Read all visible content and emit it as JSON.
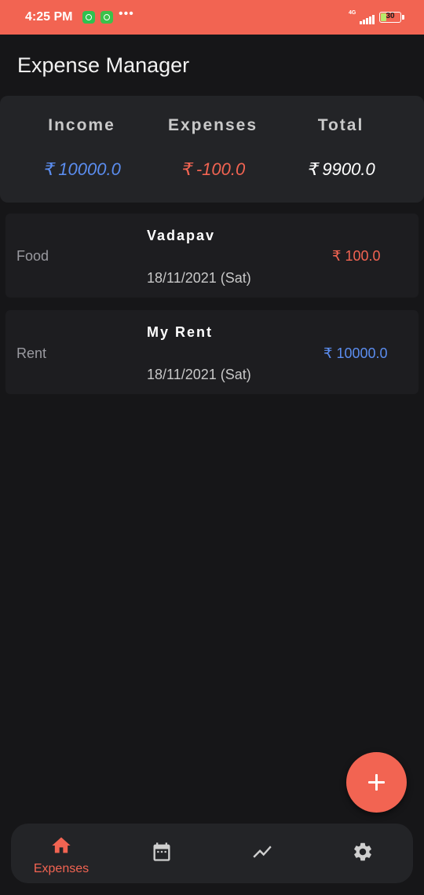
{
  "status_bar": {
    "time": "4:25 PM",
    "network": "4G",
    "battery": "30",
    "battery_level": 0.3,
    "icons": [
      "whatsapp-icon",
      "android-icon",
      "more-notifications-icon",
      "signal-icon",
      "battery-icon"
    ]
  },
  "app_bar": {
    "title": "Expense Manager"
  },
  "summary": {
    "income_label": "Income",
    "income_value": "₹ 10000.0",
    "expenses_label": "Expenses",
    "expenses_value": "₹ -100.0",
    "total_label": "Total",
    "total_value": "₹ 9900.0"
  },
  "transactions": [
    {
      "category": "Food",
      "title": "Vadapav",
      "date": "18/11/2021 (Sat)",
      "amount": "₹ 100.0",
      "type": "expense"
    },
    {
      "category": "Rent",
      "title": "My Rent",
      "date": "18/11/2021 (Sat)",
      "amount": "₹ 10000.0",
      "type": "income"
    }
  ],
  "fab": {
    "icon": "plus-icon"
  },
  "bottom_nav": {
    "items": [
      {
        "label": "Expenses",
        "icon": "home-icon",
        "active": true
      },
      {
        "label": "",
        "icon": "calendar-icon",
        "active": false
      },
      {
        "label": "",
        "icon": "chart-icon",
        "active": false
      },
      {
        "label": "",
        "icon": "gear-icon",
        "active": false
      }
    ]
  },
  "colors": {
    "accent": "#f26452",
    "income": "#5b8def",
    "expense": "#f26452",
    "background": "#161618",
    "card": "#232427"
  }
}
